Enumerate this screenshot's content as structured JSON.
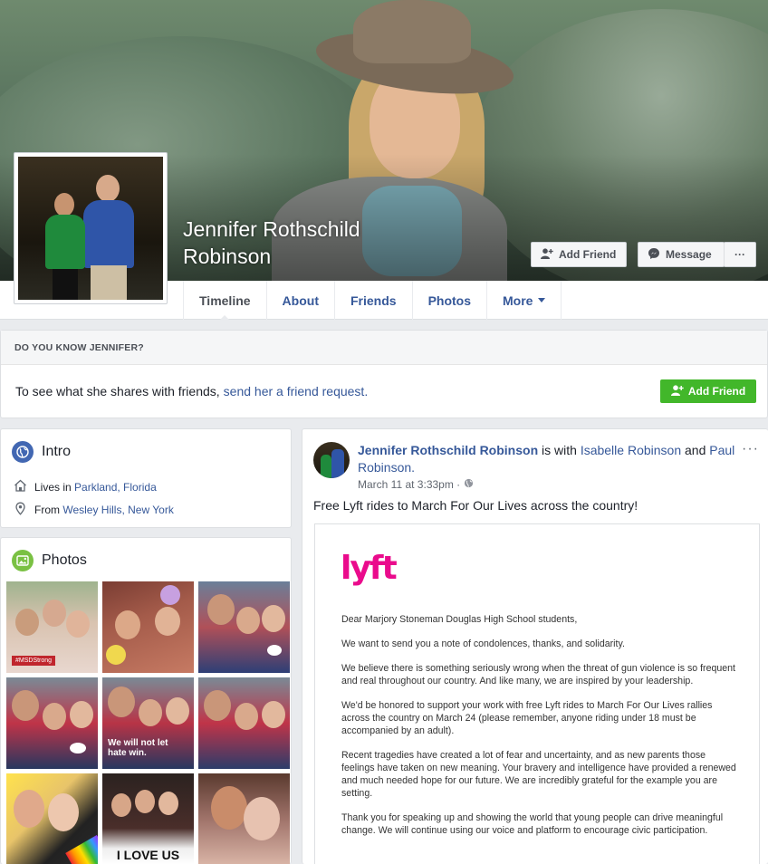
{
  "profile": {
    "name": "Jennifer Rothschild Robinson",
    "name_line1": "Jennifer Rothschild",
    "name_line2": "Robinson"
  },
  "cover_buttons": {
    "add_friend": "Add Friend",
    "message": "Message",
    "more": "···"
  },
  "tabs": [
    {
      "label": "Timeline"
    },
    {
      "label": "About"
    },
    {
      "label": "Friends"
    },
    {
      "label": "Photos"
    },
    {
      "label": "More"
    }
  ],
  "do_you_know": {
    "header": "DO YOU KNOW JENNIFER?",
    "text": "To see what she shares with friends,",
    "link": "send her a friend request.",
    "button": "Add Friend"
  },
  "intro": {
    "title": "Intro",
    "lives_prefix": "Lives in",
    "lives_place": "Parkland, Florida",
    "from_prefix": "From",
    "from_place": "Wesley Hills, New York"
  },
  "photos": {
    "title": "Photos",
    "captions": {
      "p1_tag": "#MSDStrong",
      "p5": "We will not let hate win.",
      "p8": "I LOVE US"
    }
  },
  "post": {
    "author": "Jennifer Rothschild Robinson",
    "with_text": "is with",
    "tag1": "Isabelle Robinson",
    "and_text": "and",
    "tag2": "Paul Robinson.",
    "timestamp": "March 11 at 3:33pm ·",
    "text": "Free Lyft rides to March For Our Lives across the country!",
    "options": "···",
    "letter": {
      "logo": "lyft",
      "paragraphs": [
        "Dear Marjory Stoneman Douglas High School students,",
        "We want to send you a note of condolences, thanks, and solidarity.",
        "We believe there is something seriously wrong when the threat of gun violence is so frequent and real throughout our country. And like many, we are inspired by your leadership.",
        "We'd be honored to support your work with free Lyft rides to March For Our Lives rallies across the country on March 24 (please remember, anyone riding under 18 must be accompanied by an adult).",
        "Recent tragedies have created a lot of fear and uncertainty, and as new parents those feelings have taken on new meaning. Your bravery and intelligence have provided a renewed and much needed hope for our future. We are incredibly grateful for the example you are setting.",
        "Thank you for speaking up and showing the world that young people can drive meaningful change. We will continue using our voice and platform to encourage civic participation."
      ]
    }
  },
  "colors": {
    "link": "#365899",
    "green": "#42b72a",
    "lyft": "#ea0b8c"
  }
}
